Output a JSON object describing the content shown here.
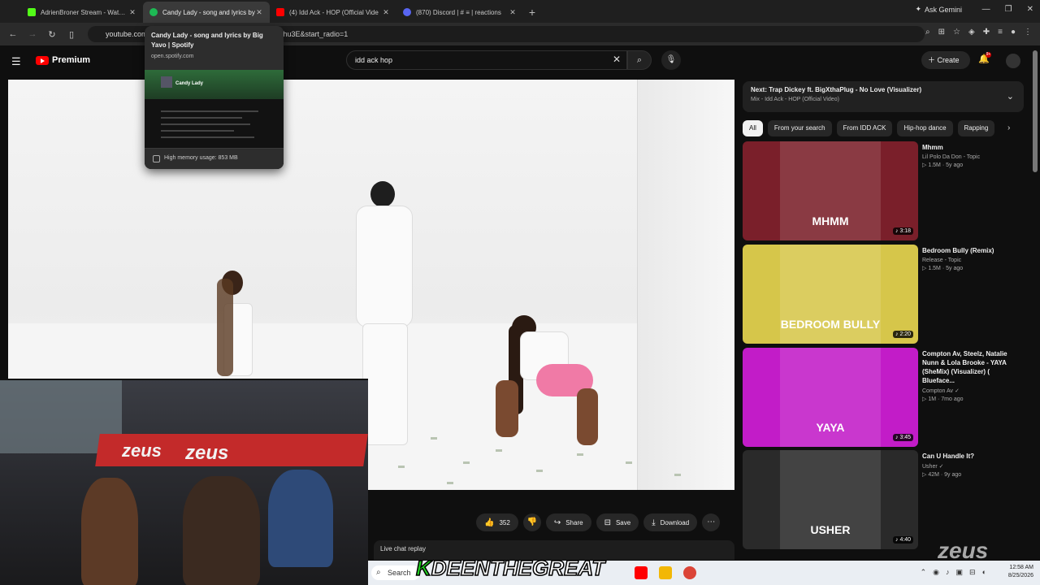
{
  "browser": {
    "tabs": [
      {
        "title": "AdrienBroner Stream - Watch L",
        "color": "#53fc18",
        "active": false
      },
      {
        "title": "Candy Lady - song and lyrics by",
        "color": "#1db954",
        "active": true
      },
      {
        "title": "(4) Idd Ack - HOP (Official Vide",
        "color": "#ff0000",
        "active": false
      },
      {
        "title": "(870) Discord | # ≡ | reactions",
        "color": "#5865f2",
        "active": false
      }
    ],
    "gemini_label": "Ask Gemini",
    "url_prefix": "youtube.com",
    "url_suffix": "/hu3E&start_radio=1"
  },
  "hover_card": {
    "title": "Candy Lady - song and lyrics by Big Yavo | Spotify",
    "domain": "open.spotify.com",
    "preview_song": "Candy Lady",
    "memory": "High memory usage: 853 MB"
  },
  "youtube": {
    "logo_text": "Premium",
    "search_value": "idd ack hop",
    "create_label": "Create",
    "notif_count": "9+",
    "like_count": "352",
    "share_label": "Share",
    "save_label": "Save",
    "download_label": "Download",
    "live_chat_label": "Live chat replay",
    "next_title": "Next: Trap Dickey ft. BigXthaPlug - No Love (Visualizer)",
    "next_sub": "Mix - Idd Ack - HOP (Official Video)",
    "chips": [
      "All",
      "From your search",
      "From IDD ACK",
      "Hip-hop dance",
      "Rapping"
    ],
    "recommendations": [
      {
        "title": "Mhmm",
        "channel": "Lil Polo Da Don - Topic",
        "stats": "▷ 1.5M · 5y ago",
        "duration": "♪ 3:18",
        "thumb": "#7a1f2a",
        "thumb_text": "MHMM"
      },
      {
        "title": "Bedroom Bully (Remix)",
        "channel": "Release - Topic",
        "stats": "▷ 1.5M · 5y ago",
        "duration": "♪ 2:20",
        "thumb": "#d6c64a",
        "thumb_text": "BEDROOM BULLY"
      },
      {
        "title": "Compton Av, Steelz, Natalie Nunn & Lola Brooke - YAYA (SheMix) (Visualizer) ( Blueface...",
        "channel": "Compton Av ✓",
        "stats": "▷ 1M · 7mo ago",
        "duration": "♪ 3:45",
        "thumb": "#c21cc8",
        "thumb_text": "YAYA"
      },
      {
        "title": "Can U Handle It?",
        "channel": "Usher ✓",
        "stats": "▷ 42M · 9y ago",
        "duration": "♪ 4:40",
        "thumb": "#2a2a2a",
        "thumb_text": "USHER"
      }
    ]
  },
  "stream": {
    "banner_text_1": "zeus",
    "banner_text_2": "zeus",
    "watermark": "KDEENTHEGREAT",
    "corner_logo": "zeus"
  },
  "taskbar": {
    "search_label": "Search",
    "time": "12:58 AM",
    "date": "8/25/2026"
  }
}
